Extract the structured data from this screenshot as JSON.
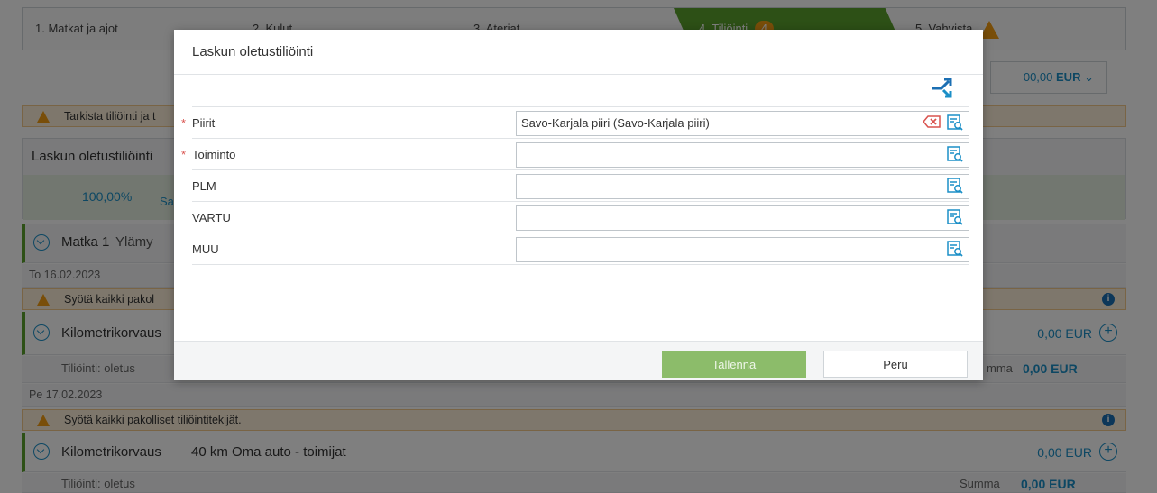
{
  "wizard": {
    "step1": "1. Matkat ja ajot",
    "step2": "2. Kulut",
    "step3": "3. Ateriat",
    "step4": "4. Tiliöinti",
    "step4_badge": "4",
    "step5": "5. Vahvista"
  },
  "total": {
    "amount": "00,00",
    "currency": "EUR"
  },
  "warning_top": "Tarkista tiliöinti ja t",
  "defaults_section": {
    "title": "Laskun oletustiliöinti",
    "percent": "100,00%",
    "piiri_short": "Sa"
  },
  "trip": {
    "label": "Matka 1",
    "description": "Ylämy",
    "date1": "To 16.02.2023",
    "warning1": "Syötä kaikki pakol",
    "item1": {
      "label": "Kilometrikorvaus",
      "amount": "0,00 EUR",
      "accounting": "Tiliöinti: oletus",
      "sum_label": "mma",
      "sum_value": "0,00 EUR"
    },
    "date2": "Pe 17.02.2023",
    "warning2": "Syötä kaikki pakolliset tiliöintitekijät.",
    "item2": {
      "label": "Kilometrikorvaus",
      "detail": "40 km Oma auto - toimijat",
      "amount": "0,00 EUR",
      "accounting": "Tiliöinti: oletus",
      "sum_label": "Summa",
      "sum_value": "0,00 EUR"
    }
  },
  "modal": {
    "title": "Laskun oletustiliöinti",
    "fields": [
      {
        "label": "Piirit",
        "required": true,
        "value": "Savo-Karjala piiri (Savo-Karjala piiri)"
      },
      {
        "label": "Toiminto",
        "required": true,
        "value": ""
      },
      {
        "label": "PLM",
        "required": false,
        "value": ""
      },
      {
        "label": "VARTU",
        "required": false,
        "value": ""
      },
      {
        "label": "MUU",
        "required": false,
        "value": ""
      }
    ],
    "save_label": "Tallenna",
    "cancel_label": "Peru"
  },
  "colors": {
    "accent": "#1b8fc7",
    "success": "#5aa02c",
    "warning": "#f39c12"
  }
}
